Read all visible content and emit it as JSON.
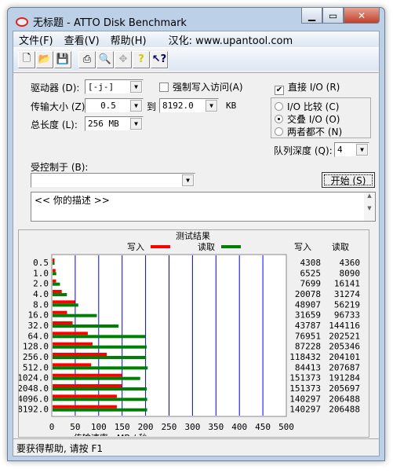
{
  "window": {
    "title": "无标题 - ATTO Disk Benchmark"
  },
  "menu": [
    "文件(F)",
    "查看(V)",
    "帮助(H)",
    "汉化: www.upantool.com"
  ],
  "toolbar": {
    "icons": [
      "new-icon",
      "open-icon",
      "save-icon",
      "print-icon",
      "print-preview-icon",
      "move-icon",
      "help-icon",
      "context-help-icon"
    ]
  },
  "settings": {
    "drive_label": "驱动器 (D):",
    "drive_value": "[-j-]",
    "force_write_label": "强制写入访问(A)",
    "force_write_checked": false,
    "transfer_label": "传输大小 (Z):",
    "transfer_from": "0.5",
    "to_label": "到",
    "transfer_to": "8192.0",
    "unit": "KB",
    "length_label": "总长度 (L):",
    "length_value": "256 MB",
    "direct_io_label": "直接 I/O (R)",
    "direct_io_checked": true,
    "radio": [
      {
        "label": "I/O 比较 (C)",
        "selected": false
      },
      {
        "label": "交叠 I/O (O)",
        "selected": true
      },
      {
        "label": "两者都不 (N)",
        "selected": false
      }
    ],
    "queue_label": "队列深度 (Q):",
    "queue_value": "4",
    "controlled_label": "受控制于 (B):",
    "controlled_value": "",
    "start_button": "开始 (S)",
    "description": "<<  你的描述   >>"
  },
  "chart_data": {
    "type": "bar",
    "title": "测试结果",
    "xlabel": "传输速率 - MB / 秒",
    "xlim": [
      0,
      500
    ],
    "xticks": [
      "0",
      "50",
      "100",
      "150",
      "200",
      "250",
      "300",
      "350",
      "400",
      "450",
      "500"
    ],
    "grid": true,
    "legend_placement": "top",
    "categories": [
      "0.5",
      "1.0",
      "2.0",
      "4.0",
      "8.0",
      "16.0",
      "32.0",
      "64.0",
      "128.0",
      "256.0",
      "512.0",
      "1024.0",
      "2048.0",
      "4096.0",
      "8192.0"
    ],
    "column_headers": [
      "写入",
      "读取"
    ],
    "series": [
      {
        "name": "写入",
        "color": "#ff0000",
        "values": [
          4308,
          6525,
          7699,
          20078,
          48907,
          31659,
          43787,
          76951,
          87228,
          118432,
          84413,
          151373,
          151373,
          140297,
          140297
        ]
      },
      {
        "name": "读取",
        "color": "#008000",
        "values": [
          4360,
          8090,
          16141,
          31274,
          56219,
          96733,
          144116,
          202521,
          205346,
          204101,
          207687,
          191284,
          205697,
          206488,
          206488
        ]
      }
    ],
    "grid_color": "#0000ff"
  },
  "status": "要获得帮助, 请按 F1"
}
